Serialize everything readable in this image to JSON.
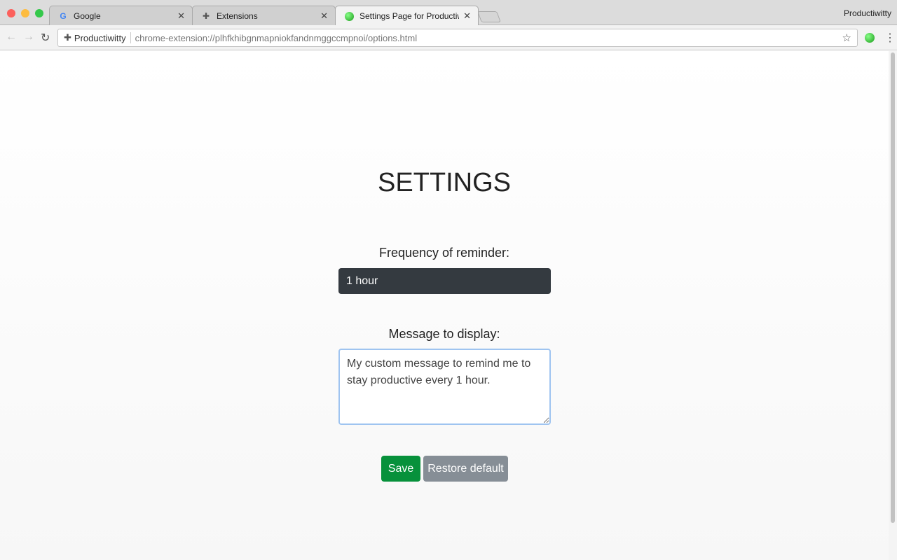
{
  "browser": {
    "tabs": [
      {
        "title": "Google",
        "icon": "google-icon"
      },
      {
        "title": "Extensions",
        "icon": "puzzle-icon"
      },
      {
        "title": "Settings Page for Productiwitty",
        "icon": "extension-ball-icon",
        "active": true
      }
    ],
    "profile": "Productiwitty",
    "omnibox": {
      "chip": "Productiwitty",
      "url": "chrome-extension://plhfkhibgnmapniokfandnmggccmpnoi/options.html"
    }
  },
  "settings": {
    "title": "SETTINGS",
    "frequency_label": "Frequency of reminder:",
    "frequency_value": "1 hour",
    "message_label": "Message to display:",
    "message_value": "My custom message to remind me to stay productive every 1 hour.",
    "save_label": "Save",
    "restore_label": "Restore default"
  },
  "colors": {
    "save": "#07913b",
    "restore": "#868e96",
    "select": "#343a40"
  }
}
